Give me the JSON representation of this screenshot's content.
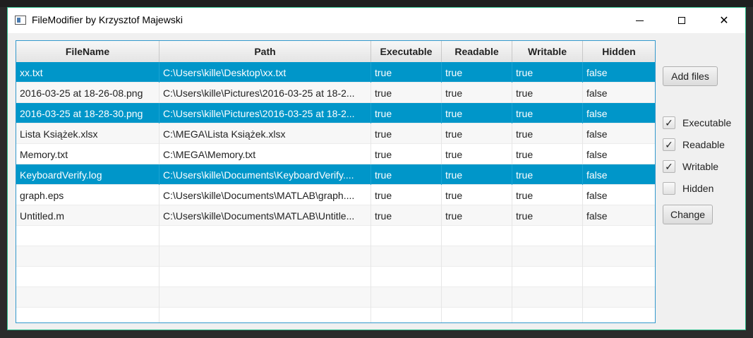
{
  "window": {
    "title": "FileModifier by Krzysztof Majewski",
    "controls": {
      "close_glyph": "✕"
    }
  },
  "table": {
    "columns": [
      "FileName",
      "Path",
      "Executable",
      "Readable",
      "Writable",
      "Hidden"
    ],
    "rows": [
      {
        "selected": true,
        "cells": [
          "xx.txt",
          "C:\\Users\\kille\\Desktop\\xx.txt",
          "true",
          "true",
          "true",
          "false"
        ]
      },
      {
        "selected": false,
        "cells": [
          "2016-03-25 at 18-26-08.png",
          "C:\\Users\\kille\\Pictures\\2016-03-25 at 18-2...",
          "true",
          "true",
          "true",
          "false"
        ]
      },
      {
        "selected": true,
        "cells": [
          "2016-03-25 at 18-28-30.png",
          "C:\\Users\\kille\\Pictures\\2016-03-25 at 18-2...",
          "true",
          "true",
          "true",
          "false"
        ]
      },
      {
        "selected": false,
        "cells": [
          "Lista Książek.xlsx",
          "C:\\MEGA\\Lista Książek.xlsx",
          "true",
          "true",
          "true",
          "false"
        ]
      },
      {
        "selected": false,
        "cells": [
          "Memory.txt",
          "C:\\MEGA\\Memory.txt",
          "true",
          "true",
          "true",
          "false"
        ]
      },
      {
        "selected": true,
        "cells": [
          "KeyboardVerify.log",
          "C:\\Users\\kille\\Documents\\KeyboardVerify....",
          "true",
          "true",
          "true",
          "false"
        ]
      },
      {
        "selected": false,
        "cells": [
          "graph.eps",
          "C:\\Users\\kille\\Documents\\MATLAB\\graph....",
          "true",
          "true",
          "true",
          "false"
        ]
      },
      {
        "selected": false,
        "cells": [
          "Untitled.m",
          "C:\\Users\\kille\\Documents\\MATLAB\\Untitle...",
          "true",
          "true",
          "true",
          "false"
        ]
      }
    ],
    "empty_rows": 5
  },
  "sidebar": {
    "add_files_label": "Add files",
    "change_label": "Change",
    "checkboxes": [
      {
        "label": "Executable",
        "checked": true
      },
      {
        "label": "Readable",
        "checked": true
      },
      {
        "label": "Writable",
        "checked": true
      },
      {
        "label": "Hidden",
        "checked": false
      }
    ],
    "check_glyph": "✓"
  },
  "colors": {
    "selection": "#0096c9",
    "table_border": "#3399cc",
    "window_border": "#2dbb8a"
  }
}
